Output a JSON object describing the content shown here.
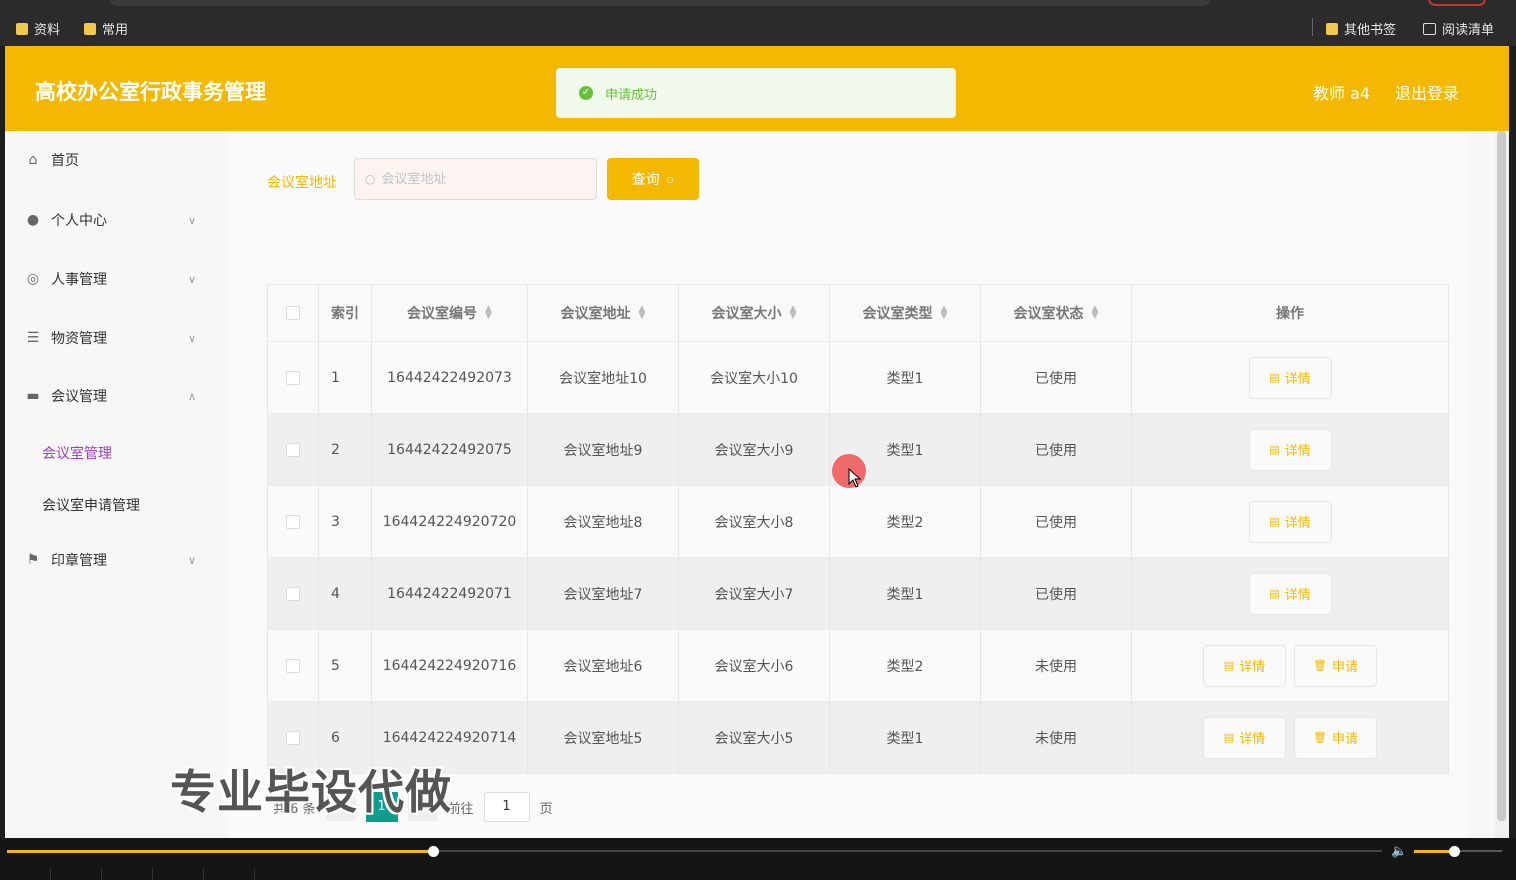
{
  "browser": {
    "bookmarks_left": [
      "资料",
      "常用"
    ],
    "bookmarks_right": [
      "其他书签",
      "阅读清单"
    ]
  },
  "header": {
    "title": "高校办公室行政事务管理",
    "user": "教师 a4",
    "logout": "退出登录"
  },
  "toast": {
    "message": "申请成功"
  },
  "sidebar": {
    "items": [
      {
        "label": "首页",
        "icon": "home-icon"
      },
      {
        "label": "个人中心",
        "icon": "user-icon"
      },
      {
        "label": "人事管理",
        "icon": "compass-icon"
      },
      {
        "label": "物资管理",
        "icon": "list-icon"
      },
      {
        "label": "会议管理",
        "icon": "monitor-icon"
      },
      {
        "label": "印章管理",
        "icon": "flag-icon"
      }
    ],
    "sub_items": [
      "会议室管理",
      "会议室申请管理"
    ]
  },
  "search": {
    "label": "会议室地址",
    "placeholder": "会议室地址",
    "button": "查询"
  },
  "table": {
    "headers": [
      "索引",
      "会议室编号",
      "会议室地址",
      "会议室大小",
      "会议室类型",
      "会议室状态",
      "操作"
    ],
    "rows": [
      {
        "index": "1",
        "number": "16442422492073",
        "address": "会议室地址10",
        "size": "会议室大小10",
        "type": "类型1",
        "status": "已使用"
      },
      {
        "index": "2",
        "number": "16442422492075",
        "address": "会议室地址9",
        "size": "会议室大小9",
        "type": "类型1",
        "status": "已使用"
      },
      {
        "index": "3",
        "number": "164424224920720",
        "address": "会议室地址8",
        "size": "会议室大小8",
        "type": "类型2",
        "status": "已使用"
      },
      {
        "index": "4",
        "number": "16442422492071",
        "address": "会议室地址7",
        "size": "会议室大小7",
        "type": "类型1",
        "status": "已使用"
      },
      {
        "index": "5",
        "number": "164424224920716",
        "address": "会议室地址6",
        "size": "会议室大小6",
        "type": "类型2",
        "status": "未使用"
      },
      {
        "index": "6",
        "number": "164424224920714",
        "address": "会议室地址5",
        "size": "会议室大小5",
        "type": "类型1",
        "status": "未使用"
      }
    ],
    "detail_label": "详情",
    "apply_label": "申请"
  },
  "pagination": {
    "total": "共 6 条",
    "current_page": "1",
    "goto_label": "前往",
    "goto_value": "1",
    "page_suffix": "页"
  },
  "overlay": {
    "watermark": "专业毕设代做"
  },
  "video": {
    "progress": 0.31,
    "volume": 0.45
  },
  "colors": {
    "accent": "#f5b800",
    "active_page": "#0f9b8e",
    "submenu_active": "#9b40c9",
    "success": "#67c23a"
  }
}
